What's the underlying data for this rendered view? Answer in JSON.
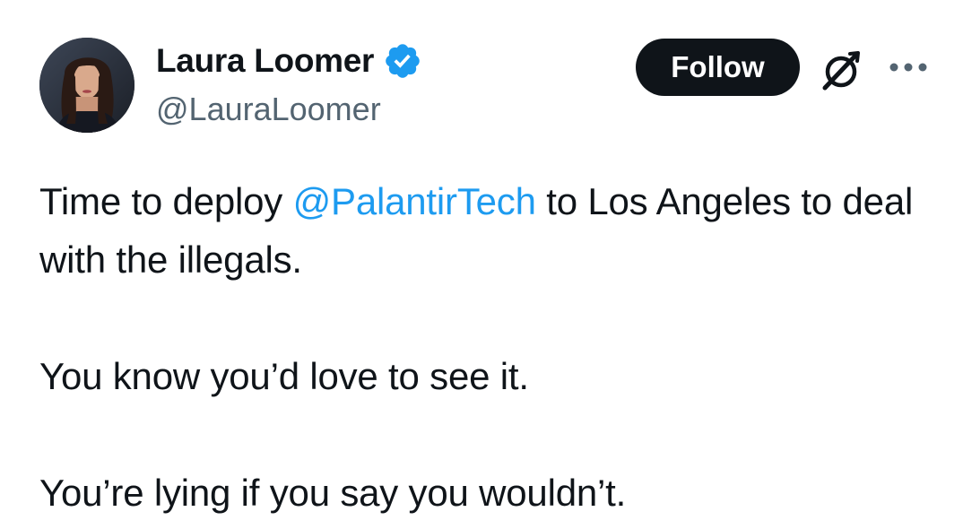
{
  "tweet": {
    "author": {
      "name": "Laura Loomer",
      "handle": "@LauraLoomer",
      "verified": true
    },
    "actions": {
      "follow_label": "Follow",
      "grok_icon": "grok-slash-icon",
      "more_icon": "more-horizontal-icon"
    },
    "text": {
      "line1_before": "Time to deploy ",
      "mention": "@PalantirTech",
      "line1_after": " to Los Angeles to deal with the illegals.",
      "paragraph2": "You know you’d love to see it.",
      "paragraph3": "You’re lying if you say you wouldn’t."
    },
    "colors": {
      "text": "#0f1419",
      "handle": "#536471",
      "link": "#1d9bf0",
      "verified_badge": "#1d9bf0",
      "follow_bg": "#0f1419",
      "follow_text": "#ffffff"
    }
  }
}
